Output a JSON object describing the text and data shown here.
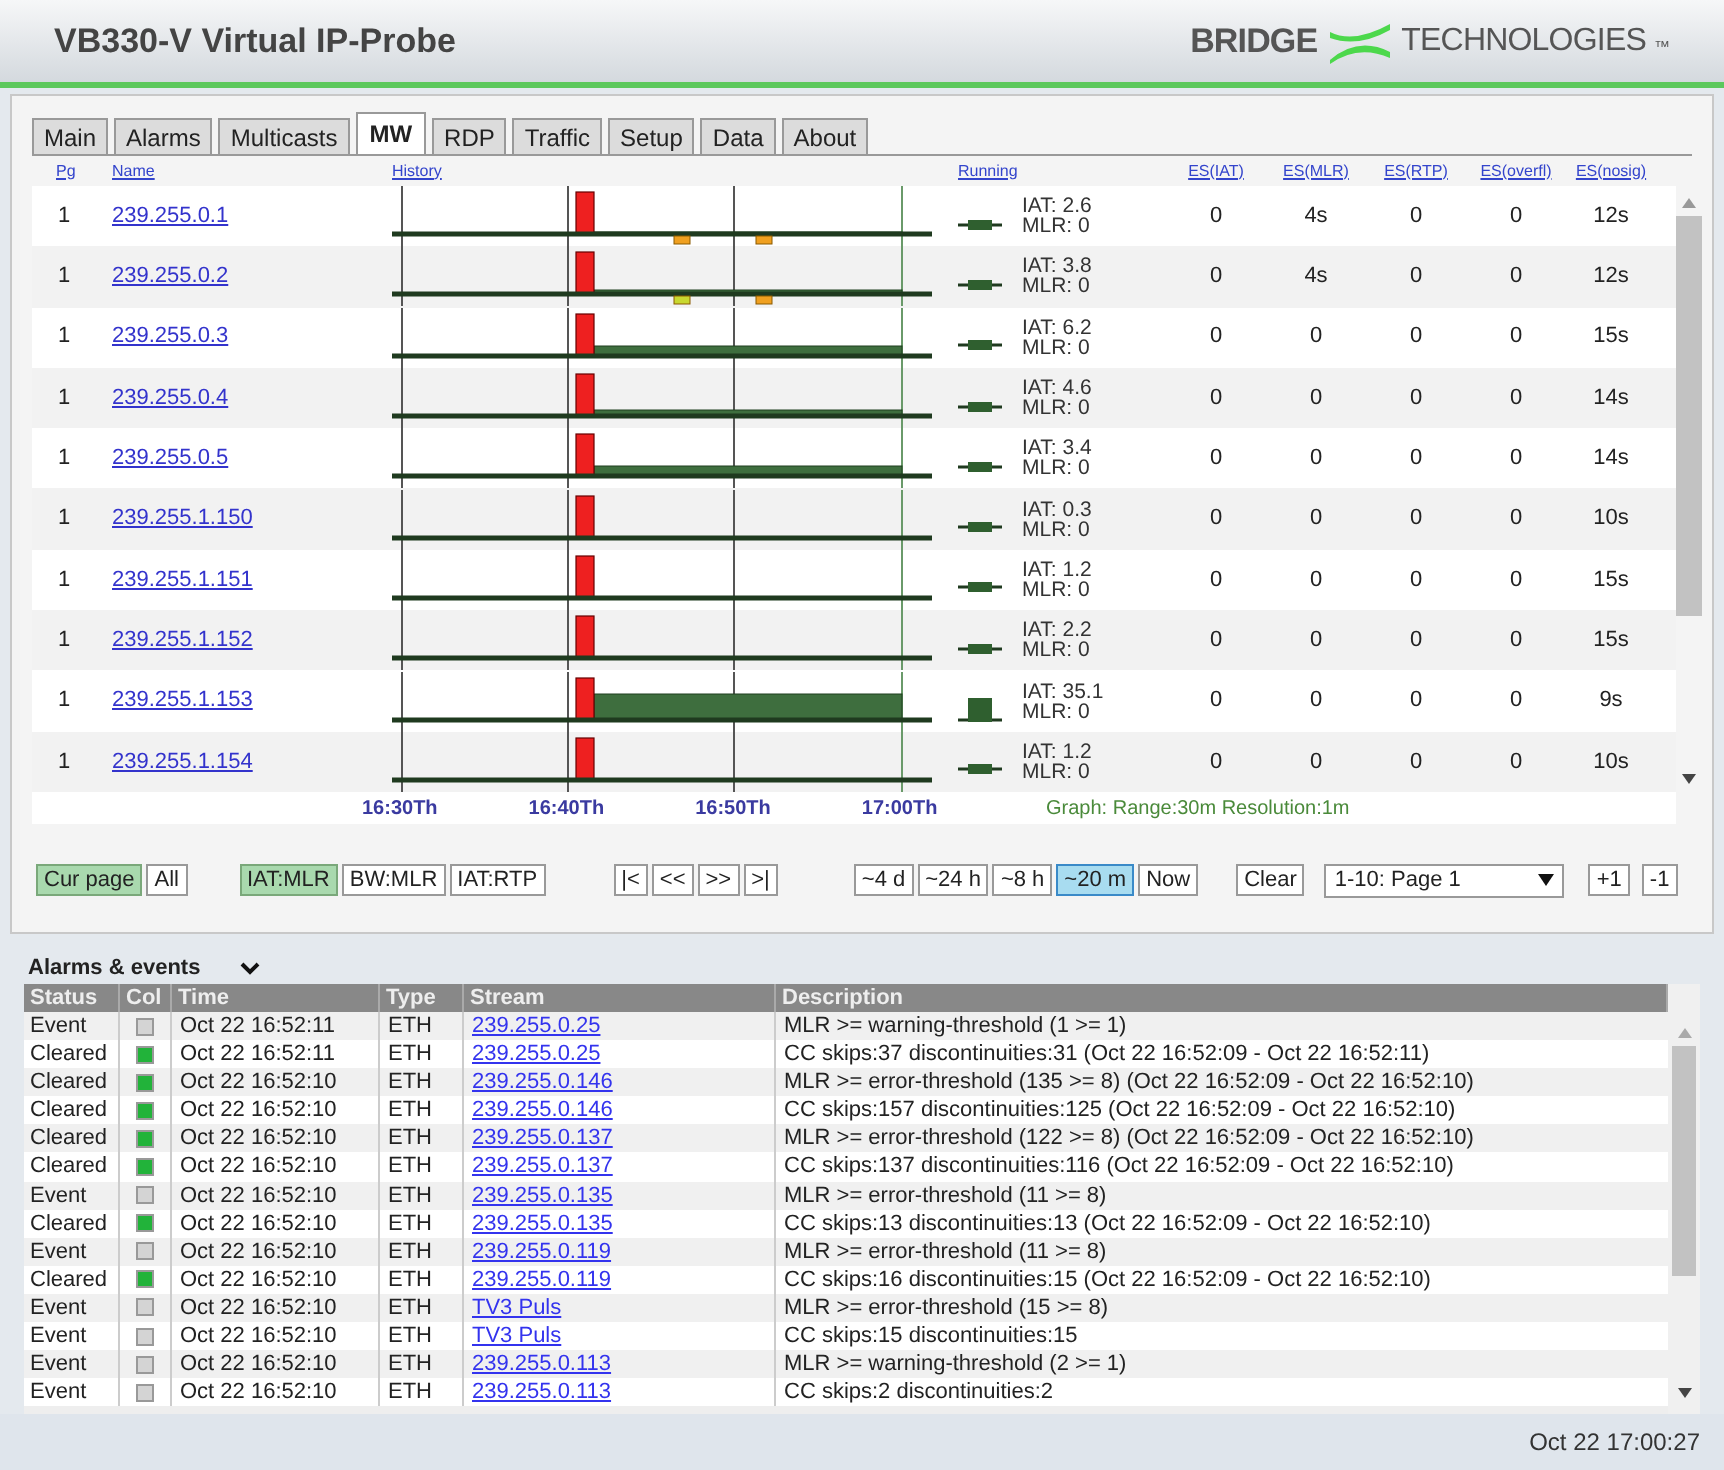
{
  "header": {
    "title": "VB330-V Virtual IP-Probe",
    "logo_left": "BRIDGE",
    "logo_right": "TECHNOLOGIES",
    "logo_mark": "™"
  },
  "tabs": [
    {
      "label": "Main",
      "selected": false
    },
    {
      "label": "Alarms",
      "selected": false
    },
    {
      "label": "Multicasts",
      "selected": false
    },
    {
      "label": "MW",
      "selected": true
    },
    {
      "label": "RDP",
      "selected": false
    },
    {
      "label": "Traffic",
      "selected": false
    },
    {
      "label": "Setup",
      "selected": false
    },
    {
      "label": "Data",
      "selected": false
    },
    {
      "label": "About",
      "selected": false
    }
  ],
  "streams": {
    "columns": [
      "Pg",
      "Name",
      "History",
      "Running",
      "ES(IAT)",
      "ES(MLR)",
      "ES(RTP)",
      "ES(overfl)",
      "ES(nosig)"
    ],
    "rows": [
      {
        "pg": "1",
        "name": "239.255.0.1",
        "iat": "IAT: 2.6",
        "mlr": "MLR: 0",
        "es": [
          "0",
          "4s",
          "0",
          "0",
          "12s"
        ]
      },
      {
        "pg": "1",
        "name": "239.255.0.2",
        "iat": "IAT: 3.8",
        "mlr": "MLR: 0",
        "es": [
          "0",
          "4s",
          "0",
          "0",
          "12s"
        ]
      },
      {
        "pg": "1",
        "name": "239.255.0.3",
        "iat": "IAT: 6.2",
        "mlr": "MLR: 0",
        "es": [
          "0",
          "0",
          "0",
          "0",
          "15s"
        ]
      },
      {
        "pg": "1",
        "name": "239.255.0.4",
        "iat": "IAT: 4.6",
        "mlr": "MLR: 0",
        "es": [
          "0",
          "0",
          "0",
          "0",
          "14s"
        ]
      },
      {
        "pg": "1",
        "name": "239.255.0.5",
        "iat": "IAT: 3.4",
        "mlr": "MLR: 0",
        "es": [
          "0",
          "0",
          "0",
          "0",
          "14s"
        ]
      },
      {
        "pg": "1",
        "name": "239.255.1.150",
        "iat": "IAT: 0.3",
        "mlr": "MLR: 0",
        "es": [
          "0",
          "0",
          "0",
          "0",
          "10s"
        ]
      },
      {
        "pg": "1",
        "name": "239.255.1.151",
        "iat": "IAT: 1.2",
        "mlr": "MLR: 0",
        "es": [
          "0",
          "0",
          "0",
          "0",
          "15s"
        ]
      },
      {
        "pg": "1",
        "name": "239.255.1.152",
        "iat": "IAT: 2.2",
        "mlr": "MLR: 0",
        "es": [
          "0",
          "0",
          "0",
          "0",
          "15s"
        ]
      },
      {
        "pg": "1",
        "name": "239.255.1.153",
        "iat": "IAT: 35.1",
        "mlr": "MLR: 0",
        "es": [
          "0",
          "0",
          "0",
          "0",
          "9s"
        ]
      },
      {
        "pg": "1",
        "name": "239.255.1.154",
        "iat": "IAT: 1.2",
        "mlr": "MLR: 0",
        "es": [
          "0",
          "0",
          "0",
          "0",
          "10s"
        ]
      }
    ],
    "time_axis": [
      "16:30Th",
      "16:40Th",
      "16:50Th",
      "17:00Th"
    ],
    "graph_info": "Graph: Range:30m Resolution:1m"
  },
  "controls": {
    "groups": [
      [
        {
          "label": "Cur page",
          "selected": true
        },
        {
          "label": "All",
          "selected": false
        }
      ],
      [
        {
          "label": "IAT:MLR",
          "selected": true
        },
        {
          "label": "BW:MLR",
          "selected": false
        },
        {
          "label": "IAT:RTP",
          "selected": false
        }
      ],
      [
        {
          "label": "|<",
          "selected": false
        },
        {
          "label": "<<",
          "selected": false
        },
        {
          "label": ">>",
          "selected": false
        },
        {
          "label": ">|",
          "selected": false
        }
      ],
      [
        {
          "label": "~4 d",
          "selected": false
        },
        {
          "label": "~24 h",
          "selected": false
        },
        {
          "label": "~8 h",
          "selected": false
        },
        {
          "label": "~20 m",
          "selected": true
        },
        {
          "label": "Now",
          "selected": false
        }
      ],
      [
        {
          "label": "Clear",
          "selected": false
        }
      ]
    ],
    "page_select": "1-10: Page 1",
    "steps": [
      "+1",
      "-1"
    ]
  },
  "alarms": {
    "title": "Alarms & events",
    "columns": [
      "Status",
      "Col",
      "Time",
      "Type",
      "Stream",
      "Description"
    ],
    "rows": [
      {
        "status": "Event",
        "color": "#d4d4d4",
        "time": "Oct 22 16:52:11",
        "type": "ETH",
        "stream": "239.255.0.25",
        "description": "MLR >= warning-threshold (1 >= 1)"
      },
      {
        "status": "Cleared",
        "color": "#22b33a",
        "time": "Oct 22 16:52:11",
        "type": "ETH",
        "stream": "239.255.0.25",
        "description": "CC skips:37 discontinuities:31 (Oct 22 16:52:09 - Oct 22 16:52:11)"
      },
      {
        "status": "Cleared",
        "color": "#22b33a",
        "time": "Oct 22 16:52:10",
        "type": "ETH",
        "stream": "239.255.0.146",
        "description": "MLR >= error-threshold (135 >= 8) (Oct 22 16:52:09 - Oct 22 16:52:10)"
      },
      {
        "status": "Cleared",
        "color": "#22b33a",
        "time": "Oct 22 16:52:10",
        "type": "ETH",
        "stream": "239.255.0.146",
        "description": "CC skips:157 discontinuities:125 (Oct 22 16:52:09 - Oct 22 16:52:10)"
      },
      {
        "status": "Cleared",
        "color": "#22b33a",
        "time": "Oct 22 16:52:10",
        "type": "ETH",
        "stream": "239.255.0.137",
        "description": "MLR >= error-threshold (122 >= 8) (Oct 22 16:52:09 - Oct 22 16:52:10)"
      },
      {
        "status": "Cleared",
        "color": "#22b33a",
        "time": "Oct 22 16:52:10",
        "type": "ETH",
        "stream": "239.255.0.137",
        "description": "CC skips:137 discontinuities:116 (Oct 22 16:52:09 - Oct 22 16:52:10)"
      },
      {
        "status": "Event",
        "color": "#d4d4d4",
        "time": "Oct 22 16:52:10",
        "type": "ETH",
        "stream": "239.255.0.135",
        "description": "MLR >= error-threshold (11 >= 8)"
      },
      {
        "status": "Cleared",
        "color": "#22b33a",
        "time": "Oct 22 16:52:10",
        "type": "ETH",
        "stream": "239.255.0.135",
        "description": "CC skips:13 discontinuities:13 (Oct 22 16:52:09 - Oct 22 16:52:10)"
      },
      {
        "status": "Event",
        "color": "#d4d4d4",
        "time": "Oct 22 16:52:10",
        "type": "ETH",
        "stream": "239.255.0.119",
        "description": "MLR >= error-threshold (11 >= 8)"
      },
      {
        "status": "Cleared",
        "color": "#22b33a",
        "time": "Oct 22 16:52:10",
        "type": "ETH",
        "stream": "239.255.0.119",
        "description": "CC skips:16 discontinuities:15 (Oct 22 16:52:09 - Oct 22 16:52:10)"
      },
      {
        "status": "Event",
        "color": "#d4d4d4",
        "time": "Oct 22 16:52:10",
        "type": "ETH",
        "stream": "TV3 Puls",
        "description": "MLR >= error-threshold (15 >= 8)"
      },
      {
        "status": "Event",
        "color": "#d4d4d4",
        "time": "Oct 22 16:52:10",
        "type": "ETH",
        "stream": "TV3 Puls",
        "description": "CC skips:15 discontinuities:15"
      },
      {
        "status": "Event",
        "color": "#d4d4d4",
        "time": "Oct 22 16:52:10",
        "type": "ETH",
        "stream": "239.255.0.113",
        "description": "MLR >= warning-threshold (2 >= 1)"
      },
      {
        "status": "Event",
        "color": "#d4d4d4",
        "time": "Oct 22 16:52:10",
        "type": "ETH",
        "stream": "239.255.0.113",
        "description": "CC skips:2 discontinuities:2"
      }
    ]
  },
  "status_bar": {
    "time": "Oct 22 17:00:27"
  }
}
